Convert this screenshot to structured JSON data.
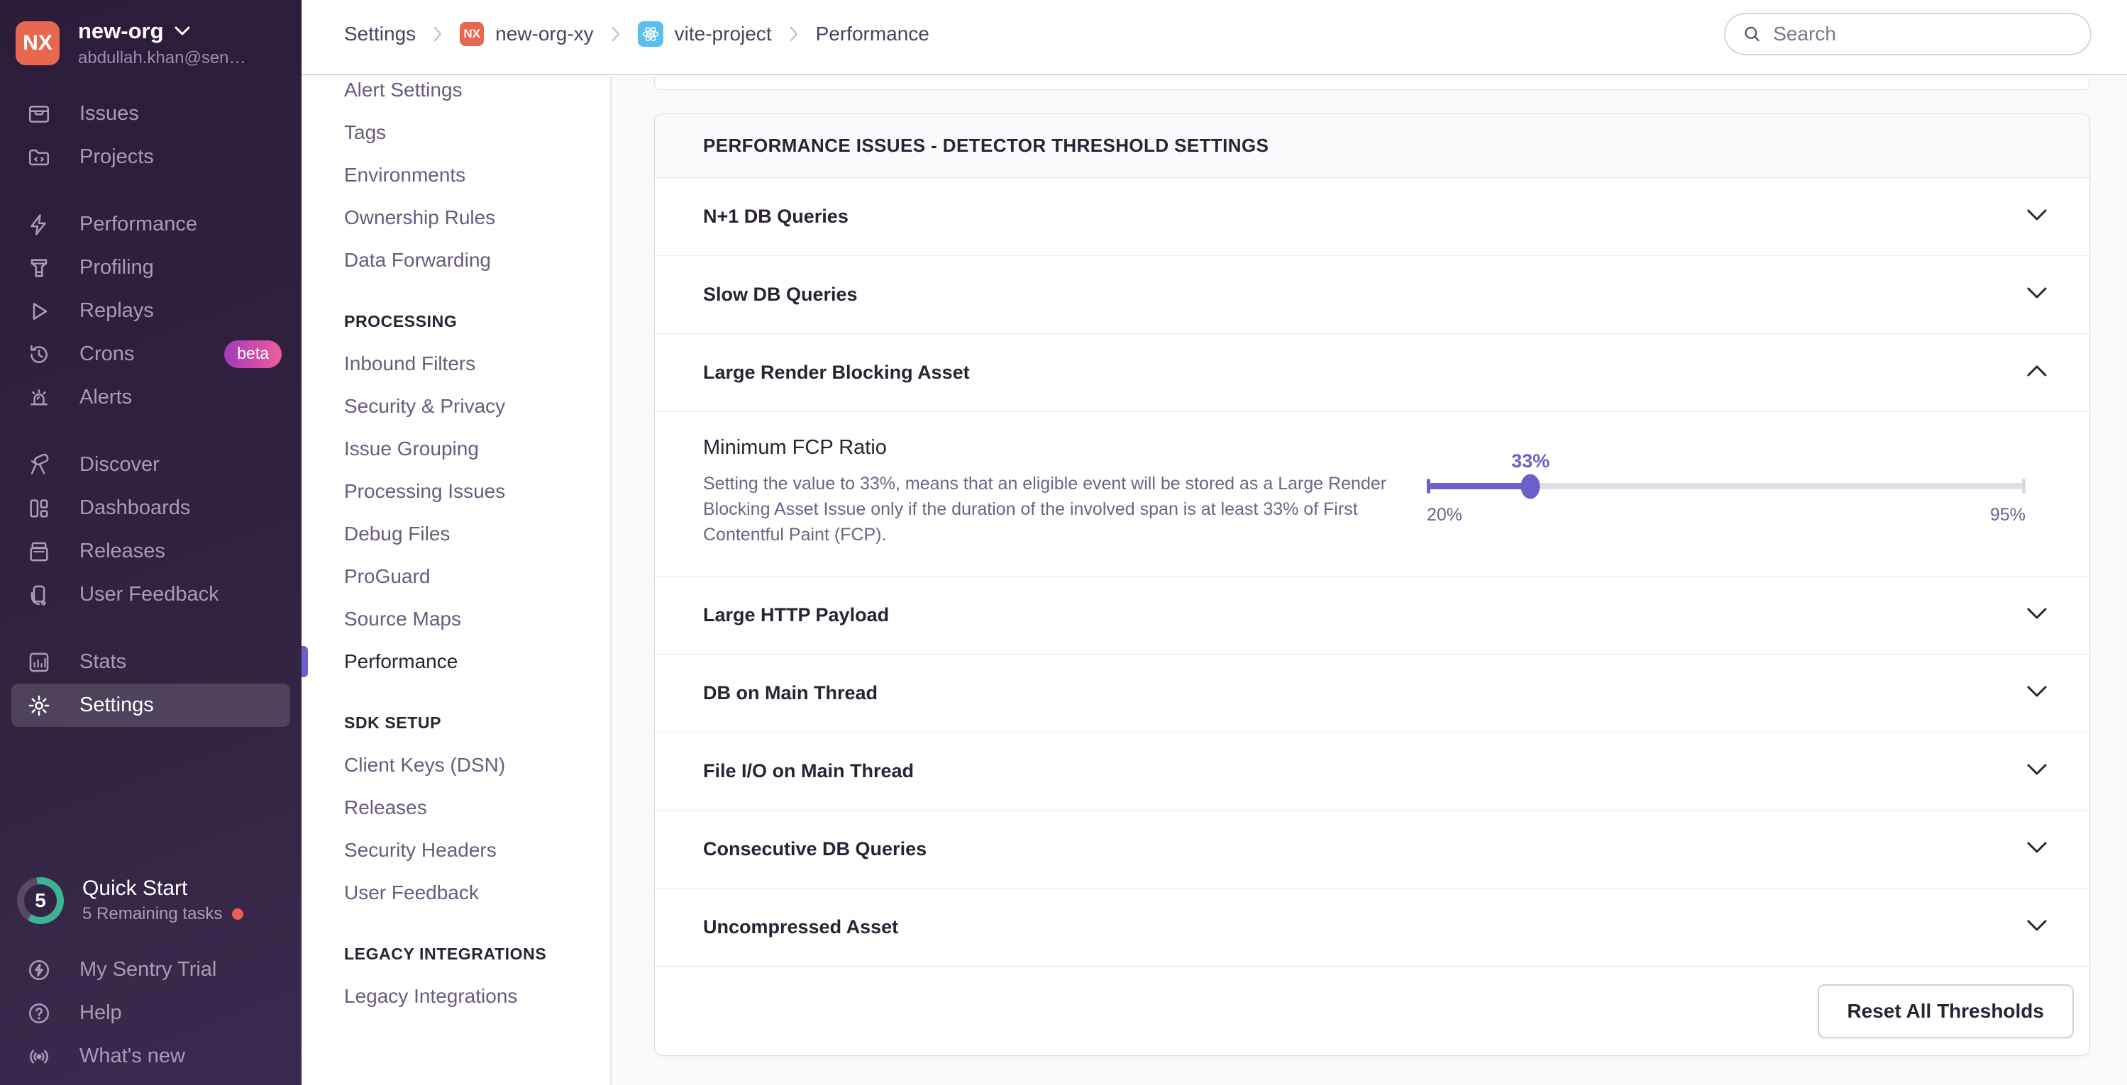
{
  "colors": {
    "accent": "#6C5FC7",
    "org_badge": "#E7684F",
    "react_badge_blue": "#5BC0E9",
    "beta_gradient_from": "#A13BBB",
    "beta_gradient_to": "#F05C9C",
    "progress_green": "#3EB295",
    "notification_red": "#EE5F51"
  },
  "sidebar": {
    "org": {
      "initials": "NX",
      "name": "new-org",
      "email": "abdullah.khan@sen…"
    },
    "items": [
      {
        "label": "Issues"
      },
      {
        "label": "Projects"
      },
      {
        "label": "Performance"
      },
      {
        "label": "Profiling"
      },
      {
        "label": "Replays"
      },
      {
        "label": "Crons",
        "badge": "beta"
      },
      {
        "label": "Alerts"
      },
      {
        "label": "Discover"
      },
      {
        "label": "Dashboards"
      },
      {
        "label": "Releases"
      },
      {
        "label": "User Feedback"
      },
      {
        "label": "Stats"
      },
      {
        "label": "Settings"
      }
    ],
    "quickstart": {
      "title": "Quick Start",
      "subtitle": "5 Remaining tasks",
      "count": "5"
    },
    "footer_items": [
      {
        "label": "My Sentry Trial"
      },
      {
        "label": "Help"
      },
      {
        "label": "What's new"
      }
    ]
  },
  "topbar": {
    "breadcrumbs": {
      "settings": "Settings",
      "org_badge": "NX",
      "org": "new-org-xy",
      "project": "vite-project",
      "page": "Performance"
    },
    "search_placeholder": "Search"
  },
  "settings_nav": {
    "items_top": [
      {
        "label": "Alert Settings"
      },
      {
        "label": "Tags"
      },
      {
        "label": "Environments"
      },
      {
        "label": "Ownership Rules"
      },
      {
        "label": "Data Forwarding"
      }
    ],
    "processing": {
      "header": "PROCESSING",
      "items": [
        {
          "label": "Inbound Filters"
        },
        {
          "label": "Security & Privacy"
        },
        {
          "label": "Issue Grouping"
        },
        {
          "label": "Processing Issues"
        },
        {
          "label": "Debug Files"
        },
        {
          "label": "ProGuard"
        },
        {
          "label": "Source Maps"
        },
        {
          "label": "Performance",
          "active": true
        }
      ]
    },
    "sdk_setup": {
      "header": "SDK SETUP",
      "items": [
        {
          "label": "Client Keys (DSN)"
        },
        {
          "label": "Releases"
        },
        {
          "label": "Security Headers"
        },
        {
          "label": "User Feedback"
        }
      ]
    },
    "legacy": {
      "header": "LEGACY INTEGRATIONS",
      "items": [
        {
          "label": "Legacy Integrations"
        }
      ]
    }
  },
  "panel": {
    "title": "PERFORMANCE ISSUES - DETECTOR THRESHOLD SETTINGS",
    "rows_before": [
      {
        "label": "N+1 DB Queries"
      },
      {
        "label": "Slow DB Queries"
      }
    ],
    "expanded_row": {
      "label": "Large Render Blocking Asset"
    },
    "detail": {
      "label": "Minimum FCP Ratio",
      "description": "Setting the value to 33%, means that an eligible event will be stored as a Large Render Blocking Asset Issue only if the duration of the involved span is at least 33% of First Contentful Paint (FCP).",
      "slider": {
        "value": 33,
        "min": 20,
        "max": 95,
        "value_label": "33%",
        "min_label": "20%",
        "max_label": "95%"
      }
    },
    "rows_after": [
      {
        "label": "Large HTTP Payload"
      },
      {
        "label": "DB on Main Thread"
      },
      {
        "label": "File I/O on Main Thread"
      },
      {
        "label": "Consecutive DB Queries"
      },
      {
        "label": "Uncompressed Asset"
      }
    ],
    "footer_button": "Reset All Thresholds"
  }
}
